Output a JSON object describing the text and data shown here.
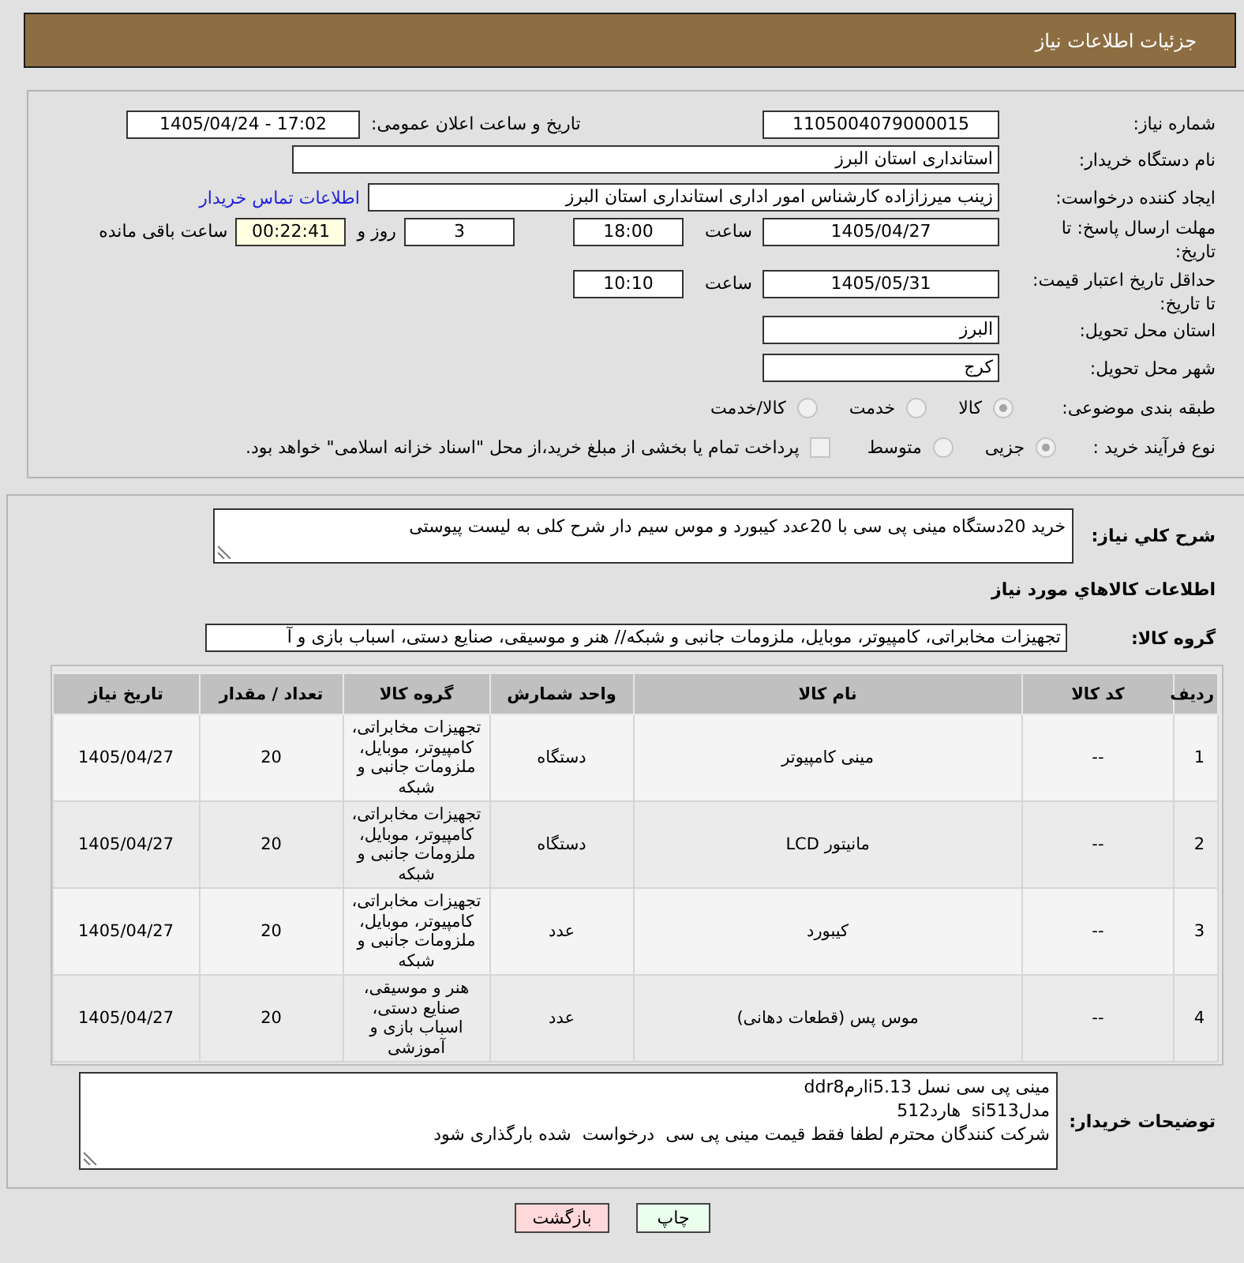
{
  "header": {
    "title": "جزئیات اطلاعات نیاز"
  },
  "need": {
    "number": {
      "label": "شماره نیاز:",
      "value": "1105004079000015"
    },
    "announce": {
      "label": "تاریخ و ساعت اعلان عمومی:",
      "value": "1405/04/24 - 17:02"
    },
    "buyer": {
      "label": "نام دستگاه خریدار:",
      "value": "استانداری استان البرز"
    },
    "requester": {
      "label": "ایجاد کننده درخواست:",
      "value": "زینب میرزازاده کارشناس امور اداری استانداری استان البرز",
      "contact_link": "اطلاعات تماس خریدار"
    },
    "reply_deadline": {
      "label": "مهلت ارسال پاسخ: تا تاریخ:",
      "date": "1405/04/27",
      "time_label": "ساعت",
      "time": "18:00",
      "days": "3",
      "days_label": "روز و",
      "remaining": "00:22:41",
      "remaining_label": "ساعت باقی مانده"
    },
    "price_validity": {
      "label": "حداقل تاریخ اعتبار قیمت: تا تاریخ:",
      "date": "1405/05/31",
      "time_label": "ساعت",
      "time": "10:10"
    },
    "delivery_province": {
      "label": "استان محل تحویل:",
      "value": "البرز"
    },
    "delivery_city": {
      "label": "شهر محل تحویل:",
      "value": "کرج"
    },
    "category": {
      "label": "طبقه بندی موضوعی:",
      "options": [
        {
          "label": "کالا",
          "selected": true
        },
        {
          "label": "خدمت",
          "selected": false
        },
        {
          "label": "کالا/خدمت",
          "selected": false
        }
      ]
    },
    "purchase_process": {
      "label": "نوع فرآیند خرید :",
      "options": [
        {
          "label": "جزیی",
          "selected": true
        },
        {
          "label": "متوسط",
          "selected": false
        }
      ],
      "treasury_payment": {
        "label": "پرداخت تمام یا بخشی از مبلغ خرید،از محل \"اسناد خزانه اسلامی\" خواهد بود.",
        "checked": false
      }
    }
  },
  "items": {
    "summary": {
      "label": "شرح کلي نياز:",
      "value": "خرید 20دستگاه مینی پی سی با 20عدد کیبورد و موس سیم دار شرح کلی به لیست پیوستی"
    },
    "section_title": "اطلاعات کالاهاي مورد نياز",
    "goods_group": {
      "label": "گروه کالا:",
      "value": "تجهیزات مخابراتی، کامپیوتر، موبایل، ملزومات جانبی و شبکه// هنر و موسیقی، صنایع دستی، اسباب بازی و آ"
    },
    "table": {
      "columns": [
        "ردیف",
        "کد کالا",
        "نام کالا",
        "واحد شمارش",
        "گروه کالا",
        "تعداد / مقدار",
        "تاریخ نیاز"
      ],
      "rows": [
        [
          "1",
          "--",
          "مینی کامپیوتر",
          "دستگاه",
          "تجهیزات مخابراتی، کامپیوتر، موبایل، ملزومات جانبی و شبکه",
          "20",
          "1405/04/27"
        ],
        [
          "2",
          "--",
          "مانیتور LCD",
          "دستگاه",
          "تجهیزات مخابراتی، کامپیوتر، موبایل، ملزومات جانبی و شبکه",
          "20",
          "1405/04/27"
        ],
        [
          "3",
          "--",
          "کیبورد",
          "عدد",
          "تجهیزات مخابراتی، کامپیوتر، موبایل، ملزومات جانبی و شبکه",
          "20",
          "1405/04/27"
        ],
        [
          "4",
          "--",
          "موس پس (قطعات دهانی)",
          "عدد",
          "هنر و موسیقی، صنایع دستی، اسباب بازی و آموزشی",
          "20",
          "1405/04/27"
        ]
      ]
    },
    "buyer_notes": {
      "label": "توضیحات خریدار:",
      "value": "مینی پی سی نسل i5.13ارمddr8\nمدلsi513  هارد512\nشرکت کنندگان محترم لطفا فقط قیمت مینی پی سی  درخواست  شده بارگذاری شود"
    }
  },
  "buttons": [
    {
      "label": "چاپ",
      "kind": "print"
    },
    {
      "label": "بازگشت",
      "kind": "back"
    }
  ]
}
